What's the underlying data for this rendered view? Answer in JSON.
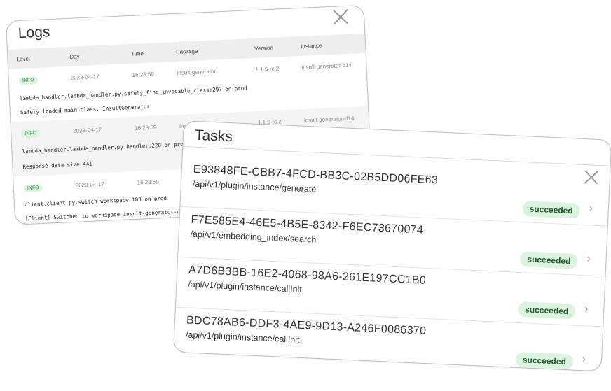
{
  "logs": {
    "title": "Logs",
    "columns": [
      "Level",
      "Day",
      "Time",
      "Package",
      "Version",
      "Instance"
    ],
    "rows": [
      {
        "level": "INFO",
        "day": "2023-04-17",
        "time": "16:28:59",
        "package": "insult-generator",
        "version": "1.1.6-rc.2",
        "instance": "insult-generator-d14",
        "lines": [
          "lambda_handler.lambda_handler.py.safely_find_invocable_class:297 on prod",
          "Safely loaded main class: InsultGenerator"
        ]
      },
      {
        "level": "INFO",
        "day": "2023-04-17",
        "time": "16:28:59",
        "package": "insult-generator",
        "version": "1.1.6-rc.2",
        "instance": "insult-generator-d14",
        "lines": [
          "lambda_handler.lambda_handler.py.handler:220 on prod",
          "Response data size 441"
        ]
      },
      {
        "level": "INFO",
        "day": "2023-04-17",
        "time": "16:28:59",
        "package": "",
        "version": "",
        "instance": "",
        "lines": [
          "client.client.py.switch_workspace:183 on prod",
          "[Client] Switched to workspace insult-generator-d"
        ]
      }
    ]
  },
  "tasks": {
    "title": "Tasks",
    "items": [
      {
        "id": "E93848FE-CBB7-4FCD-BB3C-02B5DD06FE63",
        "path": "/api/v1/plugin/instance/generate",
        "status": "succeeded"
      },
      {
        "id": "F7E585E4-46E5-4B5E-8342-F6EC73670074",
        "path": "/api/v1/embedding_index/search",
        "status": "succeeded"
      },
      {
        "id": "A7D6B3BB-16E2-4068-98A6-261E197CC1B0",
        "path": "/api/v1/plugin/instance/callInit",
        "status": "succeeded"
      },
      {
        "id": "BDC78AB6-DDF3-4AE9-9D13-A246F0086370",
        "path": "/api/v1/plugin/instance/callInit",
        "status": "succeeded"
      }
    ]
  },
  "icons": {
    "close": "close-icon",
    "chevron": "chevron-right-icon"
  },
  "colors": {
    "success_bg": "#dcf3df",
    "success_text": "#1e5a2b",
    "info_text": "#2c8a3c"
  }
}
